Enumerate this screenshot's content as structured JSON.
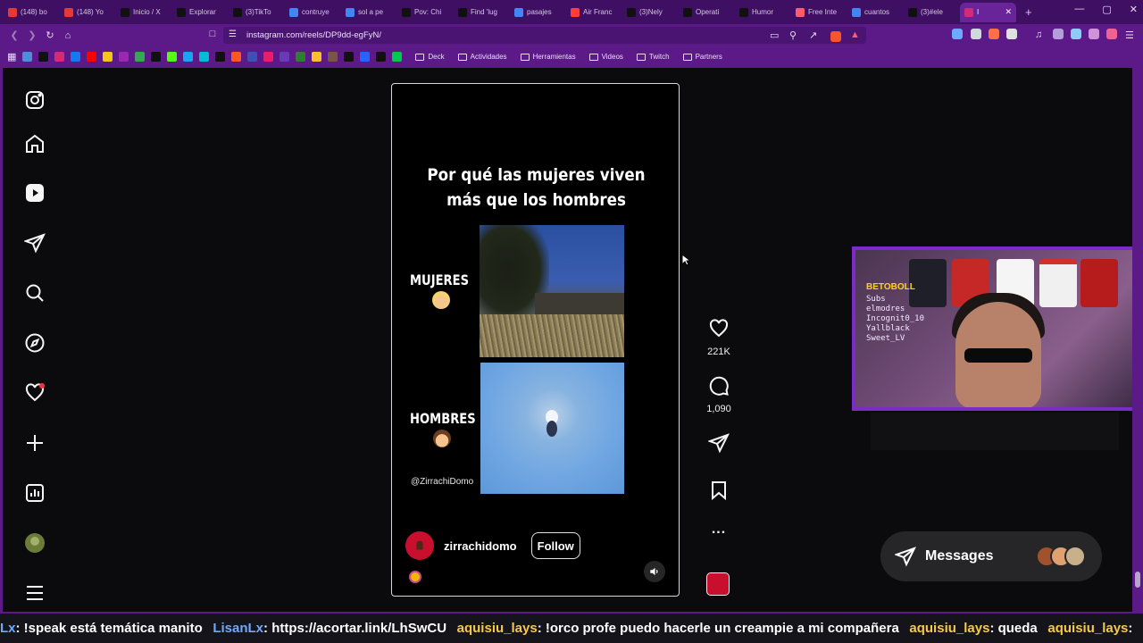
{
  "browser": {
    "tabs": [
      {
        "label": "(148) bo",
        "color": "#e53935"
      },
      {
        "label": "(148) Yo",
        "color": "#e53935"
      },
      {
        "label": "Inicio / X",
        "color": "#111111"
      },
      {
        "label": "Explorar",
        "color": "#111111"
      },
      {
        "label": "(3)TikTo",
        "color": "#111111"
      },
      {
        "label": "contruye",
        "color": "#4285f4"
      },
      {
        "label": "sol a pe",
        "color": "#4285f4"
      },
      {
        "label": "Pov: Chi",
        "color": "#111111"
      },
      {
        "label": "Find 'lug",
        "color": "#111111"
      },
      {
        "label": "pasajes",
        "color": "#4285f4"
      },
      {
        "label": "Air Franc",
        "color": "#ff3d3d"
      },
      {
        "label": "(3)Nely",
        "color": "#111111"
      },
      {
        "label": "Operati",
        "color": "#111111"
      },
      {
        "label": "Humor",
        "color": "#111111"
      },
      {
        "label": "Free Inte",
        "color": "#ff5a6e"
      },
      {
        "label": "cuantos",
        "color": "#4285f4"
      },
      {
        "label": "(3)#ele",
        "color": "#111111"
      },
      {
        "label": "I",
        "color": "#d62976",
        "active": true
      }
    ],
    "new_tab_label": "+",
    "window_controls": [
      "—",
      "▢",
      "✕"
    ],
    "url": "instagram.com/reels/DP9dd-egFyN/",
    "bookmarks": {
      "icons": [
        "#4a90d9",
        "#111111",
        "#d62976",
        "#1877f2",
        "#ff0000",
        "#f5c518",
        "#9c27b0",
        "#34a853",
        "#111111",
        "#53fc18",
        "#1da1f2",
        "#00bcd4",
        "#111111",
        "#ff5722",
        "#3f51b5",
        "#e91e63",
        "#673ab7",
        "#2e7d32",
        "#fbc02d",
        "#795548",
        "#111111",
        "#2962ff",
        "#111111",
        "#00c853"
      ],
      "folders": [
        "Deck",
        "Actividades",
        "Herramientas",
        "Videos",
        "Twitch",
        "Partners"
      ]
    }
  },
  "reel": {
    "title_line1": "Por qué las mujeres viven",
    "title_line2": "más que los hombres",
    "label_women": "MUJERES",
    "label_men": "HOMBRES",
    "handle_overlay": "@ZirrachiDomo",
    "author": "zirrachidomo",
    "follow_label": "Follow"
  },
  "actions": {
    "likes": "221K",
    "comments": "1,090",
    "more": "..."
  },
  "webcam": {
    "brand": "BETOBOLL",
    "overlay_lines": [
      "Subs",
      "elmodres",
      "Incognit0_10",
      "Yallblack",
      "Sweet_LV"
    ]
  },
  "messages": {
    "label": "Messages",
    "avatar_colors": [
      "#a0522d",
      "#e0a070",
      "#c8b08a"
    ]
  },
  "chat": {
    "segments": [
      {
        "user": "Lx",
        "cls": "user1",
        "text": " : !speak está temática manito"
      },
      {
        "user": "LisanLx",
        "cls": "user1",
        "text": " : https://acortar.link/LhSwCU"
      },
      {
        "user": "aquisiu_lays",
        "cls": "user2",
        "text": " : !orco profe puedo hacerle un creampie a mi compañera"
      },
      {
        "user": "aquisiu_lays",
        "cls": "user2",
        "text": " : queda"
      },
      {
        "user": "aquisiu_lays",
        "cls": "user2",
        "text": " :"
      }
    ]
  }
}
